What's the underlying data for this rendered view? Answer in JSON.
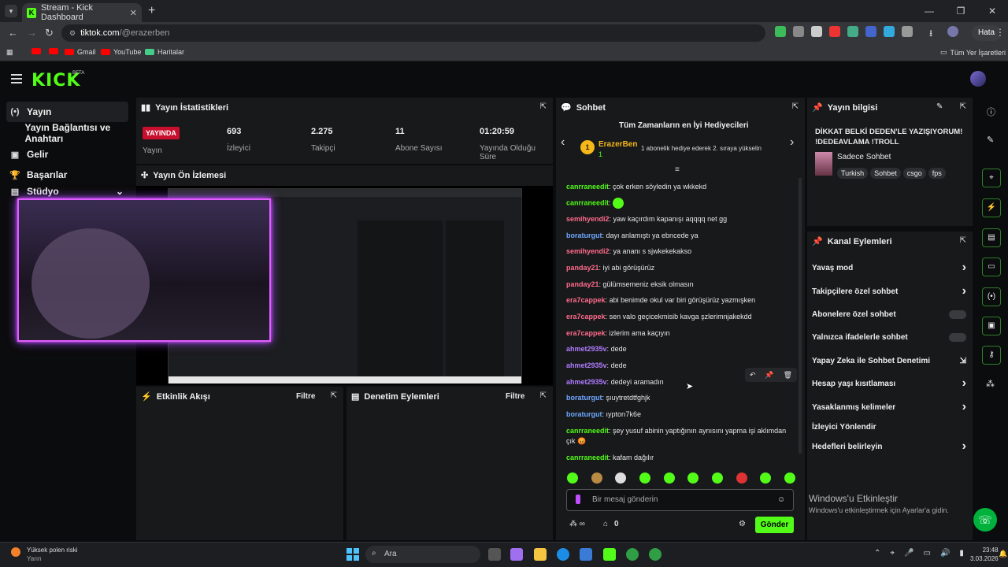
{
  "browser": {
    "tab_title": "Stream - Kick Dashboard",
    "url_domain": "tiktok.com",
    "url_path": "/@erazerben",
    "profile_button": "Hata",
    "bookmarks": [
      "Gmail",
      "YouTube",
      "Haritalar"
    ],
    "all_bookmarks": "Tüm Yer İşaretleri"
  },
  "sidebar": {
    "items": [
      {
        "label": "Yayın",
        "icon": "broadcast-icon"
      },
      {
        "label": "Yayın Bağlantısı ve Anahtarı",
        "icon": "key-icon"
      },
      {
        "label": "Gelir",
        "icon": "money-icon"
      },
      {
        "label": "Başarılar",
        "icon": "trophy-icon"
      },
      {
        "label": "Stüdyo",
        "icon": "studio-icon"
      }
    ]
  },
  "stats": {
    "title": "Yayın İstatistikleri",
    "live_badge": "YAYINDA",
    "items": [
      {
        "label": "Yayın",
        "value": ""
      },
      {
        "label": "İzleyici",
        "value": "693"
      },
      {
        "label": "Takipçi",
        "value": "2.275"
      },
      {
        "label": "Abone Sayısı",
        "value": "11"
      },
      {
        "label": "Yayında Olduğu Süre",
        "value": "01:20:59"
      }
    ]
  },
  "preview": {
    "title": "Yayın Ön İzlemesi"
  },
  "activity": {
    "title": "Etkinlik Akışı",
    "filter": "Filtre"
  },
  "moderation": {
    "title": "Denetim Eylemleri",
    "filter": "Filtre"
  },
  "chat": {
    "title": "Sohbet",
    "gifters_title": "Tüm Zamanların en İyi Hediyecileri",
    "top_gifter": {
      "rank": "1",
      "name": "ErazerBen",
      "count": "1"
    },
    "gifter_note": "1 abonelik hediye ederek 2. sıraya yükselin",
    "messages": [
      {
        "user": "canrraneedit",
        "text": "çok erken söyledin ya wkkekd",
        "color": "#53fc18"
      },
      {
        "user": "canrraneedit",
        "text": "",
        "color": "#53fc18",
        "emote": true
      },
      {
        "user": "semihyendi2",
        "text": "yaw kaçırdım kapanışı aqqqq net gg",
        "color": "#ff6b8b"
      },
      {
        "user": "boraturgut",
        "text": "dayı anlamıştı ya ebncede ya",
        "color": "#6ea8ff"
      },
      {
        "user": "semihyendi2",
        "text": "ya ananı s sjwkekekakso",
        "color": "#ff6b8b"
      },
      {
        "user": "panday21",
        "text": "iyi abi görüşürüz",
        "color": "#ff6b8b"
      },
      {
        "user": "panday21",
        "text": "gülümsemeniz eksik olmasın",
        "color": "#ff6b8b"
      },
      {
        "user": "era7cappek",
        "text": "abi benimde okul var biri görüşürüz yazmışken",
        "color": "#ff6b8b"
      },
      {
        "user": "era7cappek",
        "text": "sen valo geçicekmisib kavga şzlerimnjakekdd",
        "color": "#ff6b8b"
      },
      {
        "user": "era7cappek",
        "text": "izlerim ama kaçıyın",
        "color": "#ff6b8b"
      },
      {
        "user": "ahmet2935v",
        "text": "dede",
        "color": "#b07cff"
      },
      {
        "user": "ahmet2935v",
        "text": "dede",
        "color": "#b07cff"
      },
      {
        "user": "ahmet2935v",
        "text": "dedeyi aramadın",
        "color": "#b07cff"
      },
      {
        "user": "boraturgut",
        "text": "şıuytretdtfghjk",
        "color": "#6ea8ff"
      },
      {
        "user": "boraturgut",
        "text": "ıyptorı7k6e",
        "color": "#6ea8ff"
      },
      {
        "user": "canrraneedit",
        "text": "şey yusuf abinin yaptığının aynısını yapma işi aklımdan çık 😡",
        "color": "#53fc18"
      },
      {
        "user": "canrraneedit",
        "text": "kafam dağılır",
        "color": "#53fc18"
      }
    ],
    "input_placeholder": "Bir mesaj gönderin",
    "points": "0",
    "send": "Gönder"
  },
  "stream_info": {
    "title_label": "Yayın bilgisi",
    "title": "DİKKAT BELKİ DEDEN'LE YAZIŞIYORUM! !DEDEAVLAMA !TROLL",
    "category": "Sadece Sohbet",
    "tags": [
      "Turkish",
      "Sohbet",
      "csgo",
      "fps"
    ]
  },
  "channel_actions": {
    "title": "Kanal Eylemleri",
    "items": [
      {
        "label": "Yavaş mod",
        "kind": "arrow"
      },
      {
        "label": "Takipçilere özel sohbet",
        "kind": "arrow"
      },
      {
        "label": "Abonelere özel sohbet",
        "kind": "toggle"
      },
      {
        "label": "Yalnızca ifadelerle sohbet",
        "kind": "toggle"
      },
      {
        "label": "Yapay Zeka ile Sohbet Denetimi",
        "kind": "ext"
      },
      {
        "label": "Hesap yaşı kısıtlaması",
        "kind": "arrow"
      },
      {
        "label": "Yasaklanmış kelimeler",
        "kind": "arrow"
      },
      {
        "label": "İzleyici Yönlendir",
        "kind": "none"
      },
      {
        "label": "Hedefleri belirleyin",
        "kind": "arrow"
      }
    ]
  },
  "windows": {
    "activate_title": "Windows'u Etkinleştir",
    "activate_sub": "Windows'u etkinleştirmek için Ayarlar'a gidin.",
    "weather_title": "Yüksek polen riski",
    "weather_sub": "Yarın",
    "search": "Ara",
    "time": "23:48",
    "date": "3.03.2026"
  }
}
